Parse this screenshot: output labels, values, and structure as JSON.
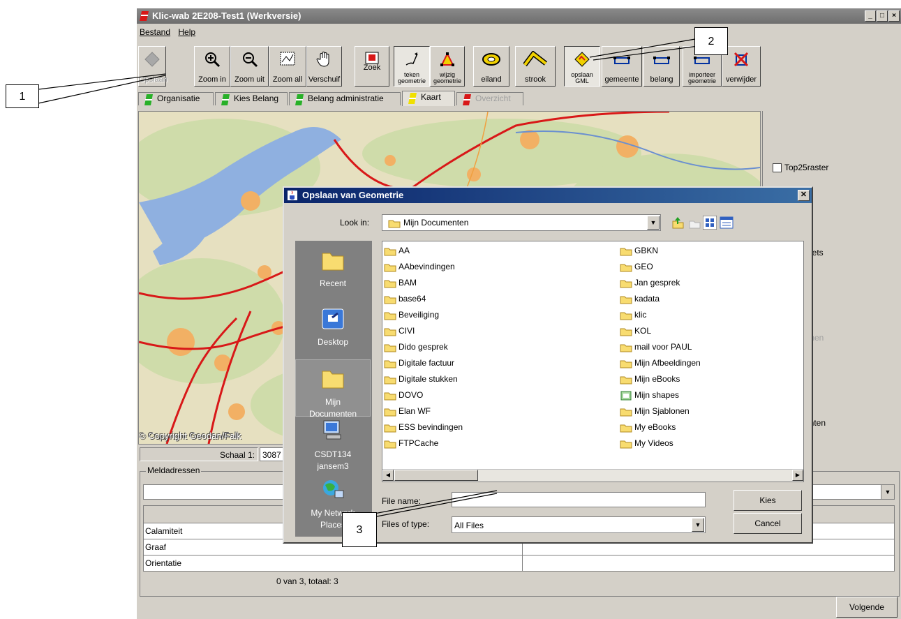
{
  "window": {
    "title": "Klic-wab 2E208-Test1 (Werkversie)"
  },
  "menu": [
    "Bestand",
    "Help"
  ],
  "toolbar": [
    {
      "label": "Opslaan",
      "icon": "save-disk-icon"
    },
    {
      "label": "Zoom in",
      "icon": "zoom-in-icon"
    },
    {
      "label": "Zoom uit",
      "icon": "zoom-out-icon"
    },
    {
      "label": "Zoom all",
      "icon": "zoom-all-icon"
    },
    {
      "label": "Verschuif",
      "icon": "hand-pan-icon"
    },
    {
      "label": "Zoek",
      "icon": "find-icon"
    },
    {
      "label": "teken geometrie",
      "icon": "draw-geometry-icon"
    },
    {
      "label": "wijzig geometrie",
      "icon": "edit-geometry-icon"
    },
    {
      "label": "eiland",
      "icon": "island-icon"
    },
    {
      "label": "strook",
      "icon": "strip-icon"
    },
    {
      "label": "opslaan GML",
      "icon": "save-gml-icon"
    },
    {
      "label": "gemeente",
      "icon": "municipality-icon"
    },
    {
      "label": "belang",
      "icon": "interest-icon"
    },
    {
      "label": "importeer geometrie",
      "icon": "import-geometry-icon"
    },
    {
      "label": "verwijder",
      "icon": "delete-icon"
    }
  ],
  "tabs": [
    {
      "label": "Organisatie",
      "light": "green"
    },
    {
      "label": "Kies Belang",
      "light": "green"
    },
    {
      "label": "Belang administratie",
      "light": "green"
    },
    {
      "label": "Kaart",
      "light": "yellow"
    },
    {
      "label": "Overzicht",
      "light": "red"
    }
  ],
  "map": {
    "copyright": "© Copyright Geodan/Falk"
  },
  "scale": {
    "label": "Schaal 1:",
    "value": "3087"
  },
  "right_panel": {
    "checkbox_label": "Top25raster",
    "partial_1": "reets",
    "partial_2": "ijnen",
    "partial_3": "enten"
  },
  "meldadressen": {
    "title": "Meldadressen",
    "rows": [
      "Calamiteit",
      "Graaf",
      "Orientatie"
    ],
    "count": "0 van 3, totaal: 3"
  },
  "volgende_label": "Volgende",
  "dialog": {
    "title": "Opslaan van Geometrie",
    "look_in_label": "Look in:",
    "look_in_value": "Mijn Documenten",
    "places": [
      {
        "label": "Recent",
        "icon": "folder-icon"
      },
      {
        "label": "Desktop",
        "icon": "desktop-icon"
      },
      {
        "label": "Mijn Documenten",
        "icon": "folder-icon"
      },
      {
        "label": "CSDT134 jansem3",
        "icon": "computer-icon"
      },
      {
        "label": "My Network Places",
        "icon": "network-icon"
      }
    ],
    "files_col1": [
      "AA",
      "AAbevindingen",
      "BAM",
      "base64",
      "Beveiliging",
      "CIVI",
      "Dido gesprek",
      "Digitale factuur",
      "Digitale stukken",
      "DOVO",
      "Elan WF",
      "ESS bevindingen",
      "FTPCache"
    ],
    "files_col2": [
      "GBKN",
      "GEO",
      "Jan gesprek",
      "kadata",
      "klic",
      "KOL",
      "mail voor PAUL",
      "Mijn Afbeeldingen",
      "Mijn eBooks",
      "Mijn shapes",
      "Mijn Sjablonen",
      "My eBooks",
      "My Videos"
    ],
    "file_name_label": "File name:",
    "file_name_value": "",
    "file_type_label": "Files of type:",
    "file_type_value": "All Files",
    "kies_label": "Kies",
    "cancel_label": "Cancel"
  },
  "callouts": [
    "1",
    "2",
    "3"
  ]
}
